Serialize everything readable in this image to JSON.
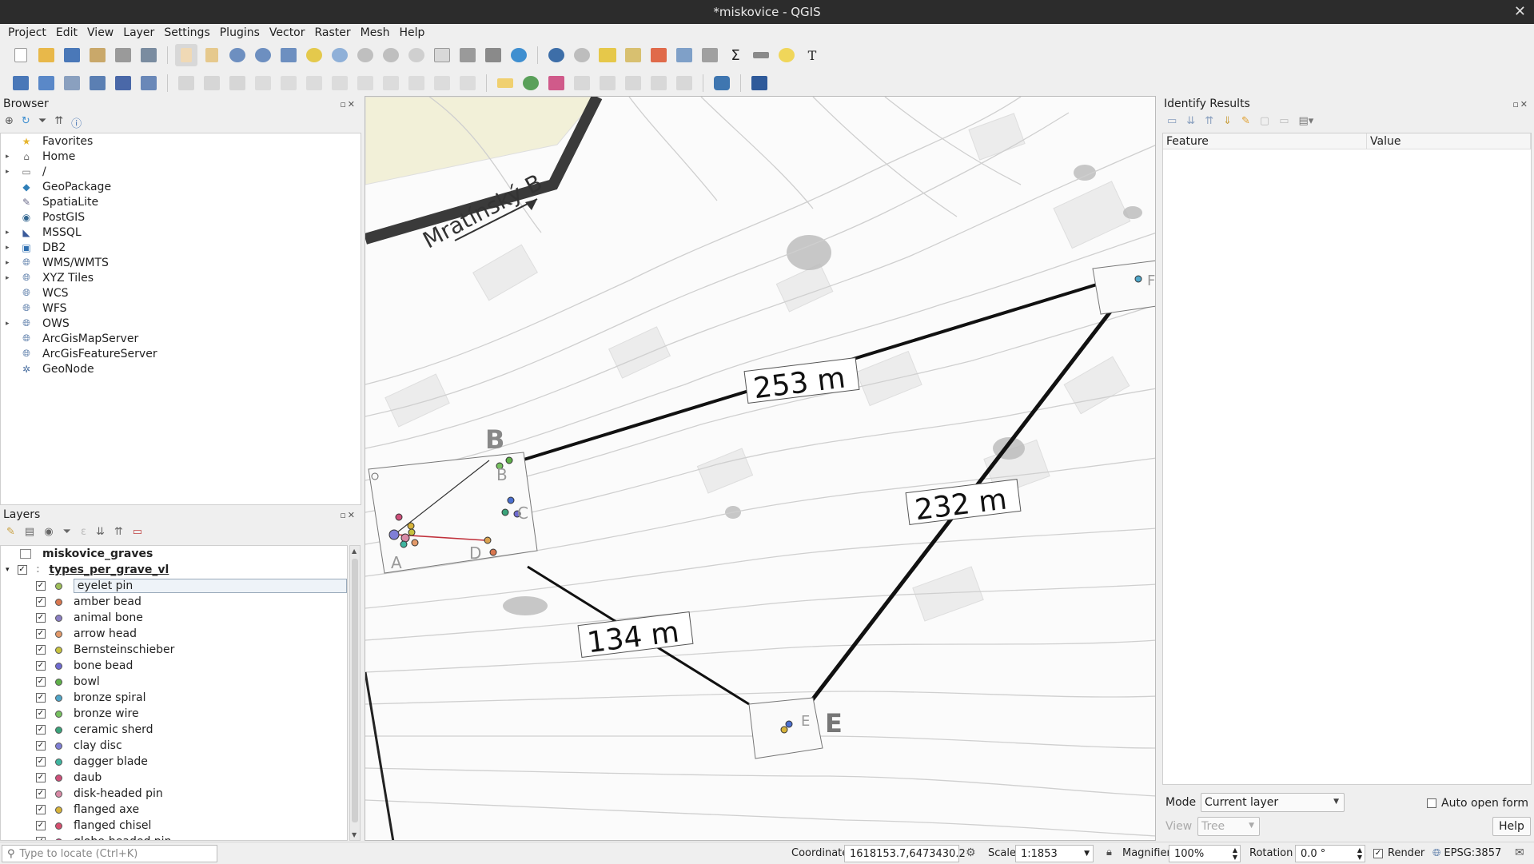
{
  "window": {
    "title": "*miskovice - QGIS"
  },
  "menu": [
    "Project",
    "Edit",
    "View",
    "Layer",
    "Settings",
    "Plugins",
    "Vector",
    "Raster",
    "Mesh",
    "Help"
  ],
  "browser": {
    "title": "Browser",
    "items": [
      {
        "label": "Favorites",
        "icon": "star-icon",
        "expandable": false
      },
      {
        "label": "Home",
        "icon": "home-folder-icon",
        "expandable": true
      },
      {
        "label": "/",
        "icon": "folder-icon",
        "expandable": true
      },
      {
        "label": "GeoPackage",
        "icon": "geopackage-icon",
        "expandable": false
      },
      {
        "label": "SpatiaLite",
        "icon": "spatialite-icon",
        "expandable": false
      },
      {
        "label": "PostGIS",
        "icon": "postgis-icon",
        "expandable": false
      },
      {
        "label": "MSSQL",
        "icon": "mssql-icon",
        "expandable": true
      },
      {
        "label": "DB2",
        "icon": "db2-icon",
        "expandable": true
      },
      {
        "label": "WMS/WMTS",
        "icon": "globe-icon",
        "expandable": true
      },
      {
        "label": "XYZ Tiles",
        "icon": "globe-icon",
        "expandable": true
      },
      {
        "label": "WCS",
        "icon": "globe-icon",
        "expandable": false
      },
      {
        "label": "WFS",
        "icon": "globe-icon",
        "expandable": false
      },
      {
        "label": "OWS",
        "icon": "globe-icon",
        "expandable": true
      },
      {
        "label": "ArcGisMapServer",
        "icon": "globe-icon",
        "expandable": false
      },
      {
        "label": "ArcGisFeatureServer",
        "icon": "globe-icon",
        "expandable": false
      },
      {
        "label": "GeoNode",
        "icon": "geonode-icon",
        "expandable": false
      }
    ]
  },
  "layers": {
    "title": "Layers",
    "groups": [
      {
        "label": "miskovice_graves"
      },
      {
        "label": "types_per_grave_vl"
      }
    ],
    "items": [
      {
        "label": "eyelet pin",
        "color": "#9fbf5a",
        "selected": true
      },
      {
        "label": "amber bead",
        "color": "#d9774f"
      },
      {
        "label": "animal bone",
        "color": "#8b7fc4"
      },
      {
        "label": "arrow head",
        "color": "#e39a6a"
      },
      {
        "label": "Bernsteinschieber",
        "color": "#c7c23f"
      },
      {
        "label": "bone bead",
        "color": "#6f6bd1"
      },
      {
        "label": "bowl",
        "color": "#5fb04a"
      },
      {
        "label": "bronze spiral",
        "color": "#4fa6c9"
      },
      {
        "label": "bronze wire",
        "color": "#77c160"
      },
      {
        "label": "ceramic sherd",
        "color": "#3aa37a"
      },
      {
        "label": "clay disc",
        "color": "#7f7fd6"
      },
      {
        "label": "dagger blade",
        "color": "#3fb5a0"
      },
      {
        "label": "daub",
        "color": "#cf4f7a"
      },
      {
        "label": "disk-headed pin",
        "color": "#d98aa6"
      },
      {
        "label": "flanged axe",
        "color": "#d7b33a"
      },
      {
        "label": "flanged chisel",
        "color": "#d64f6f"
      },
      {
        "label": "globe-headed pin",
        "color": "#c94f8a"
      }
    ]
  },
  "identify": {
    "title": "Identify Results",
    "columns": [
      "Feature",
      "Value"
    ],
    "mode_label": "Mode",
    "mode_value": "Current layer",
    "auto_open_label": "Auto open form",
    "view_label": "View",
    "view_value": "Tree",
    "help_label": "Help"
  },
  "map": {
    "road_label": "Mratínský B",
    "distances": [
      "253 m",
      "232 m",
      "134 m"
    ],
    "sites": [
      "A",
      "B",
      "C",
      "D",
      "E",
      "F"
    ]
  },
  "status": {
    "locate_placeholder": "Type to locate (Ctrl+K)",
    "coordinate_label": "Coordinate",
    "coordinate_value": "1618153.7,6473430.2",
    "scale_label": "Scale",
    "scale_value": "1:1853",
    "magnifier_label": "Magnifier",
    "magnifier_value": "100%",
    "rotation_label": "Rotation",
    "rotation_value": "0.0 °",
    "render_label": "Render",
    "crs_label": "EPSG:3857"
  }
}
